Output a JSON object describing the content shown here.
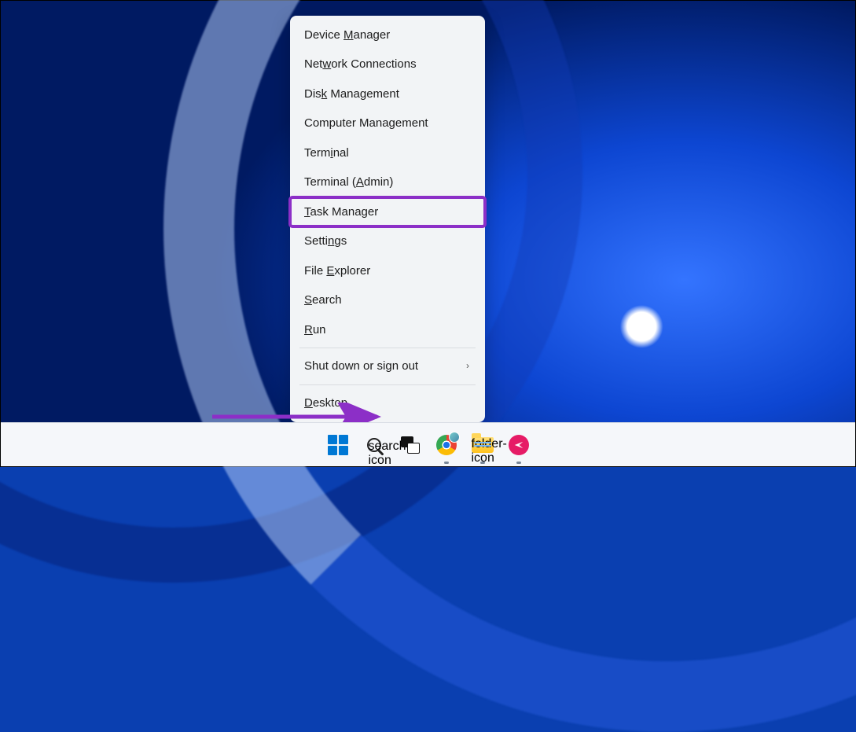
{
  "menu": {
    "items": [
      {
        "label": "Device Manager",
        "ul": "M",
        "submenu": false,
        "highlight": false
      },
      {
        "label": "Network Connections",
        "ul": "w",
        "submenu": false,
        "highlight": false
      },
      {
        "label": "Disk Management",
        "ul": "k",
        "submenu": false,
        "highlight": false
      },
      {
        "label": "Computer Management",
        "ul": "",
        "submenu": false,
        "highlight": false
      },
      {
        "label": "Terminal",
        "ul": "i",
        "submenu": false,
        "highlight": false
      },
      {
        "label": "Terminal (Admin)",
        "ul": "A",
        "submenu": false,
        "highlight": false
      },
      {
        "label": "Task Manager",
        "ul": "T",
        "submenu": false,
        "highlight": true
      },
      {
        "label": "Settings",
        "ul": "n",
        "submenu": false,
        "highlight": false
      },
      {
        "label": "File Explorer",
        "ul": "E",
        "submenu": false,
        "highlight": false
      },
      {
        "label": "Search",
        "ul": "S",
        "submenu": false,
        "highlight": false
      },
      {
        "label": "Run",
        "ul": "R",
        "submenu": false,
        "highlight": false
      },
      {
        "label": "Shut down or sign out",
        "ul": "U",
        "submenu": true,
        "highlight": false,
        "sep_before": true
      },
      {
        "label": "Desktop",
        "ul": "D",
        "submenu": false,
        "highlight": false,
        "sep_before": true
      }
    ]
  },
  "taskbar": {
    "items": [
      {
        "name": "start-button",
        "icon": "start-icon",
        "running": false
      },
      {
        "name": "search-button",
        "icon": "search-icon",
        "running": false
      },
      {
        "name": "task-view-button",
        "icon": "task-view-icon",
        "running": false
      },
      {
        "name": "chrome-button",
        "icon": "chrome-icon",
        "running": true
      },
      {
        "name": "file-explorer-button",
        "icon": "folder-icon",
        "running": true
      },
      {
        "name": "app-button",
        "icon": "pink-app-icon",
        "running": true
      }
    ]
  },
  "annotation": {
    "arrow_color": "#8c2fc7"
  }
}
